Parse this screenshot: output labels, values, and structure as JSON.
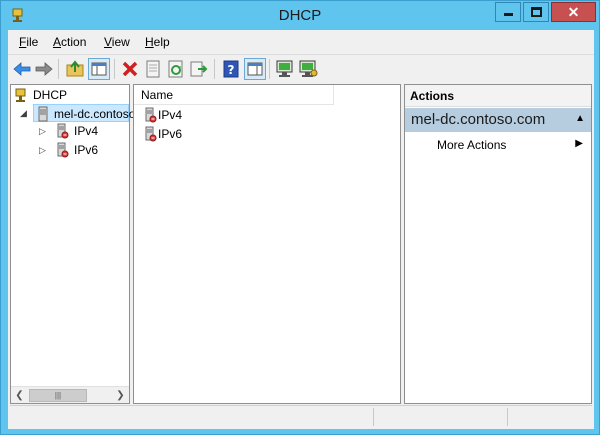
{
  "window": {
    "title": "DHCP"
  },
  "menu": [
    {
      "label": "File",
      "accel": "F",
      "rest": "ile"
    },
    {
      "label": "Action",
      "accel": "A",
      "rest": "ction"
    },
    {
      "label": "View",
      "accel": "V",
      "rest": "iew"
    },
    {
      "label": "Help",
      "accel": "H",
      "rest": "elp"
    }
  ],
  "toolbar": [
    "back-icon",
    "forward-icon",
    "up-folder-icon",
    "show-hide-console-tree-icon",
    "delete-icon",
    "properties-icon",
    "refresh-icon",
    "export-list-icon",
    "help-icon",
    "show-hide-action-pane-icon",
    "authorize-server-icon",
    "manage-authorized-servers-icon"
  ],
  "tree": {
    "root": "DHCP",
    "server": "mel-dc.contoso",
    "children": [
      "IPv4",
      "IPv6"
    ]
  },
  "list": {
    "column": "Name",
    "rows": [
      "IPv4",
      "IPv6"
    ]
  },
  "actions": {
    "header": "Actions",
    "section": "mel-dc.contoso.com",
    "items": [
      "More Actions"
    ]
  },
  "colors": {
    "frame": "#5fc4ee",
    "close_button": "#c75050",
    "selection": "#cce8ff",
    "actions_section": "#b6cde0"
  }
}
